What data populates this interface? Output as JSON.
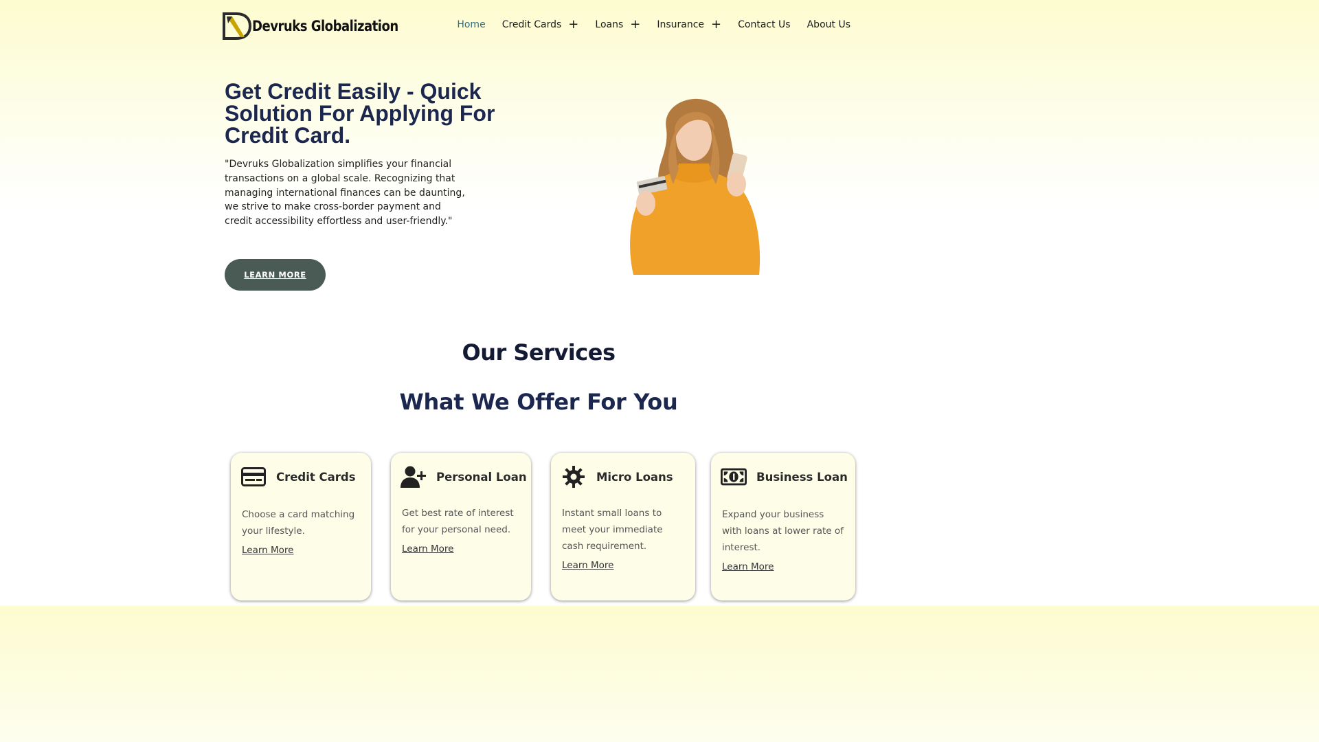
{
  "header": {
    "logo_text": "Devruks Globalization",
    "nav": [
      {
        "label": "Home",
        "has_submenu": false,
        "active": true
      },
      {
        "label": "Credit Cards",
        "has_submenu": true,
        "active": false
      },
      {
        "label": "Loans",
        "has_submenu": true,
        "active": false
      },
      {
        "label": "Insurance",
        "has_submenu": true,
        "active": false
      },
      {
        "label": "Contact Us",
        "has_submenu": false,
        "active": false
      },
      {
        "label": "About Us",
        "has_submenu": false,
        "active": false
      }
    ],
    "submenu_glyph": "+"
  },
  "hero": {
    "title": "Get Credit Easily - Quick Solution For Applying For Credit Card.",
    "text": "\"Devruks Globalization simplifies your financial transactions on a global scale. Recognizing that managing international finances can be daunting, we strive to make cross-border payment and credit accessibility effortless and user-friendly.\"",
    "button_label": "LEARN MORE"
  },
  "services": {
    "heading": "Our Services",
    "subheading": "What We Offer For You",
    "cards": [
      {
        "icon": "credit-card-icon",
        "title": "Credit Cards",
        "description": "Choose a card matching your lifestyle.",
        "link": "Learn More "
      },
      {
        "icon": "user-plus-icon",
        "title": "Personal Loan",
        "description": "Get best rate of interest for your personal need.",
        "link": "Learn More "
      },
      {
        "icon": "gear-icon",
        "title": "Micro Loans",
        "description": "Instant small loans to meet your immediate cash requirement.",
        "link": "Learn More "
      },
      {
        "icon": "money-bill-icon",
        "title": "Business Loan",
        "description": "Expand your business with loans at lower rate of interest.",
        "link": "Learn More "
      }
    ]
  },
  "colors": {
    "accent_nav": "#2f6f86",
    "title": "#1c2750",
    "button_bg": "#4a5b55",
    "card_bg": "#fdfde8"
  }
}
